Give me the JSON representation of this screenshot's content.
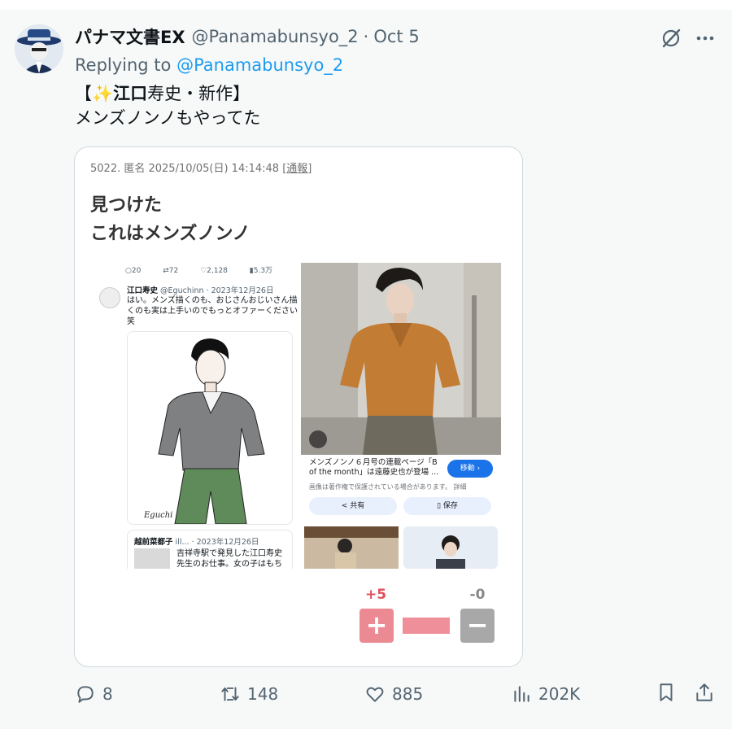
{
  "tweet": {
    "display_name": "パナマ文書EX",
    "handle": "@Panamabunsyo_2",
    "separator": "·",
    "date": "Oct 5",
    "replying_prefix": "Replying to ",
    "replying_to": "@Panamabunsyo_2",
    "text_line1_open": "【",
    "text_line1_emoji": "✨",
    "text_line1_bold": "江口",
    "text_line1_rest": "寿史・新作】",
    "text_line2": "メンズノンノもやってた"
  },
  "media": {
    "post_meta": "5022. 匿名 2025/10/05(日) 14:14:48",
    "report_label": "[通報]",
    "body_line1": "見つけた",
    "body_line2": "これはメンズノンノ",
    "collage": {
      "action_row": [
        "20",
        "72",
        "2,128",
        "5.3万"
      ],
      "inner_name": "江口寿史",
      "inner_handle": "@Eguchinn · 2023年12月26日",
      "inner_text": "はい。メンズ描くのも、おじさんおじいさん描くのも実は上手いのでもっとオファーください笑",
      "signature": "Eguchi",
      "quote_head_name": "越前菜都子",
      "quote_head_rest": "ill... · 2023年12月26日",
      "quote_text": "吉祥寺駅で発見した江口寿史先生のお仕事。女の子はもち",
      "caption": "メンズノンノ６月号の連載ページ「B of the month」は遠藤史也が登場 ...",
      "move_label": "移動 ›",
      "notice": "画像は著作権で保護されている場合があります。 詳細",
      "share_label": "共有",
      "save_label": "保存"
    },
    "vote": {
      "plus_count": "+5",
      "minus_count": "-0",
      "plus_symbol": "+",
      "minus_symbol": "−"
    }
  },
  "actions": {
    "replies": "8",
    "retweets": "148",
    "likes": "885",
    "views": "202K"
  },
  "colors": {
    "accent": "#1d9bf0",
    "muted": "#536471",
    "vote_plus": "#e0505a",
    "vote_minus": "#888888"
  }
}
